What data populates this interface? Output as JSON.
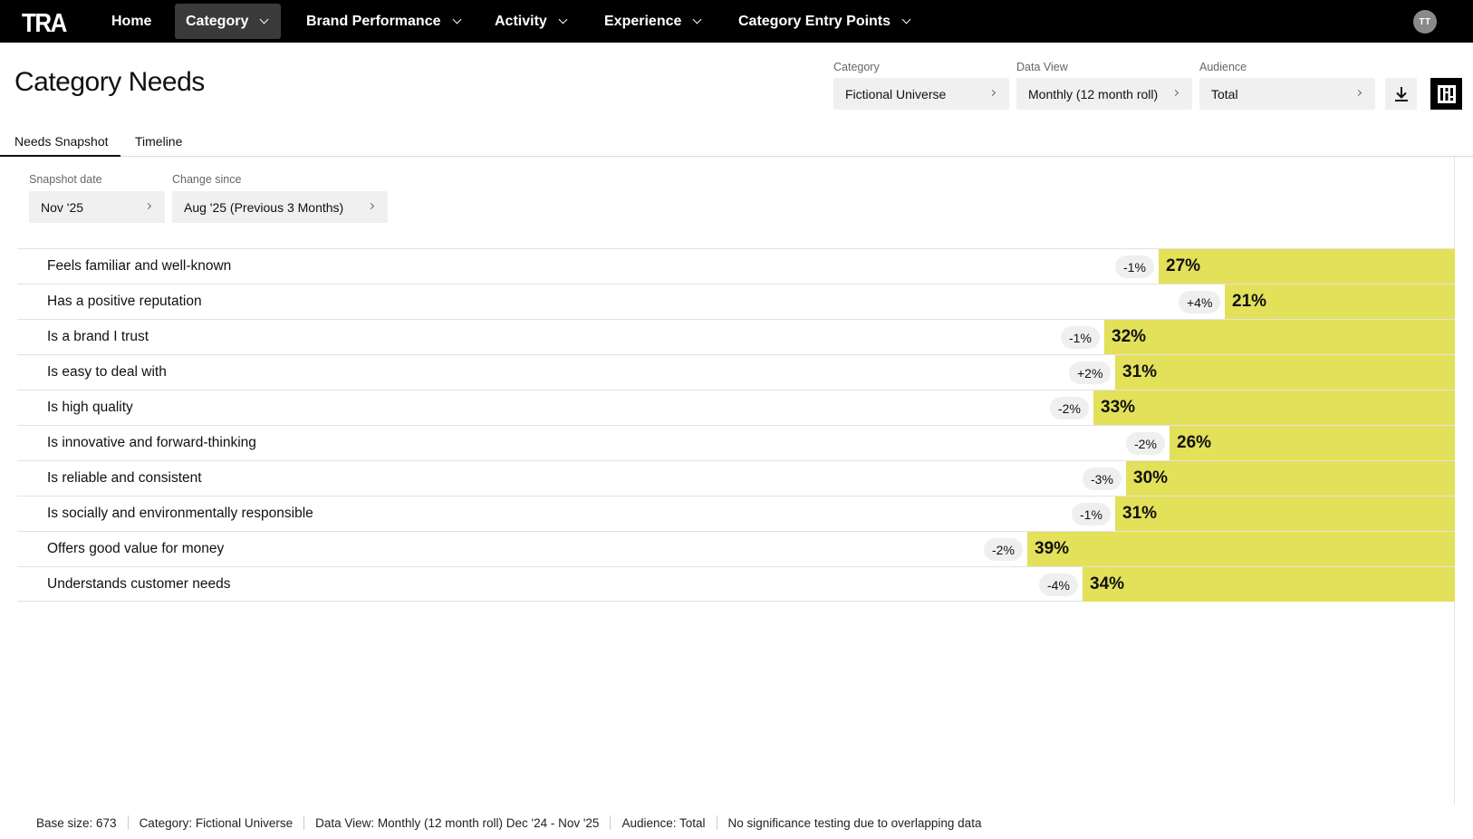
{
  "nav": {
    "logo": "TRA",
    "items": [
      {
        "label": "Home",
        "active": false,
        "dropdown": false
      },
      {
        "label": "Category",
        "active": true,
        "dropdown": true
      },
      {
        "label": "Brand Performance",
        "active": false,
        "dropdown": true
      },
      {
        "label": "Activity",
        "active": false,
        "dropdown": true
      },
      {
        "label": "Experience",
        "active": false,
        "dropdown": true
      },
      {
        "label": "Category Entry Points",
        "active": false,
        "dropdown": true
      }
    ],
    "avatar": "TT"
  },
  "page": {
    "title": "Category Needs"
  },
  "filters": {
    "category": {
      "label": "Category",
      "value": "Fictional Universe"
    },
    "data_view": {
      "label": "Data View",
      "value": "Monthly (12 month roll)"
    },
    "audience": {
      "label": "Audience",
      "value": "Total"
    }
  },
  "tabs": [
    {
      "label": "Needs Snapshot",
      "active": true
    },
    {
      "label": "Timeline",
      "active": false
    }
  ],
  "snapshot": {
    "snapshot_date": {
      "label": "Snapshot date",
      "value": "Nov '25"
    },
    "change_since": {
      "label": "Change since",
      "value": "Aug '25 (Previous 3 Months)"
    }
  },
  "needs": [
    {
      "label": "Feels familiar and well-known",
      "value": 27,
      "value_text": "27%",
      "change": "-1%"
    },
    {
      "label": "Has a positive reputation",
      "value": 21,
      "value_text": "21%",
      "change": "+4%"
    },
    {
      "label": "Is a brand I trust",
      "value": 32,
      "value_text": "32%",
      "change": "-1%"
    },
    {
      "label": "Is easy to deal with",
      "value": 31,
      "value_text": "31%",
      "change": "+2%"
    },
    {
      "label": "Is high quality",
      "value": 33,
      "value_text": "33%",
      "change": "-2%"
    },
    {
      "label": "Is innovative and forward-thinking",
      "value": 26,
      "value_text": "26%",
      "change": "-2%"
    },
    {
      "label": "Is reliable and consistent",
      "value": 30,
      "value_text": "30%",
      "change": "-3%"
    },
    {
      "label": "Is socially and environmentally responsible",
      "value": 31,
      "value_text": "31%",
      "change": "-1%"
    },
    {
      "label": "Offers good value for money",
      "value": 39,
      "value_text": "39%",
      "change": "-2%"
    },
    {
      "label": "Understands customer needs",
      "value": 34,
      "value_text": "34%",
      "change": "-4%"
    }
  ],
  "footer": {
    "base_size": "Base size: 673",
    "category": "Category: Fictional Universe",
    "data_view": "Data View: Monthly (12 month roll) Dec '24 - Nov '25",
    "audience": "Audience: Total",
    "note": "No significance testing due to overlapping data"
  },
  "colors": {
    "bar": "#e3e05a",
    "nav_bg": "#000000",
    "nav_active": "#3a3a3a"
  }
}
